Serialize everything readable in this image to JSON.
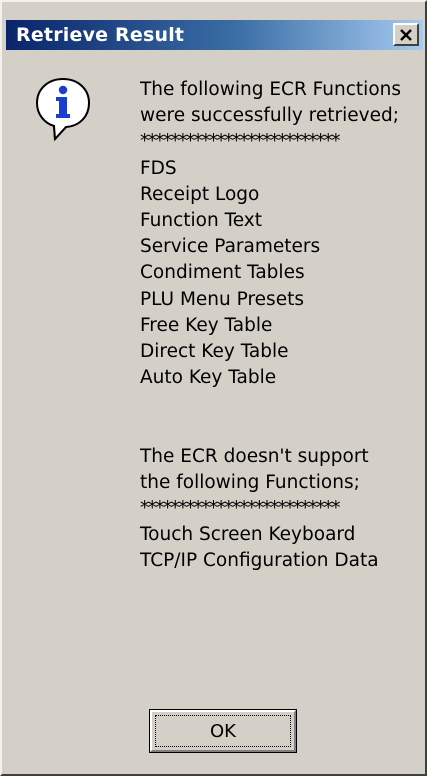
{
  "window": {
    "title": "Retrieve Result",
    "close_symbol": "×"
  },
  "icon": {
    "name": "information-icon",
    "glyph": "i"
  },
  "message": {
    "retrieved_intro": [
      "The following ECR Functions",
      "were successfully retrieved;"
    ],
    "separator": "**************************",
    "retrieved_functions": [
      "FDS",
      "Receipt Logo",
      "Function Text",
      "Service Parameters",
      "Condiment Tables",
      "PLU Menu Presets",
      "Free Key Table",
      "Direct Key Table",
      "Auto Key Table"
    ],
    "unsupported_intro": [
      "The ECR doesn't support",
      "the following Functions;"
    ],
    "unsupported_functions": [
      "Touch Screen Keyboard",
      "TCP/IP Configuration Data"
    ]
  },
  "buttons": {
    "ok_label": "OK"
  },
  "colors": {
    "face": "#d4d0c8",
    "title_start": "#0a246a",
    "title_end": "#a6caf0",
    "icon_blue": "#1a3fcf"
  }
}
